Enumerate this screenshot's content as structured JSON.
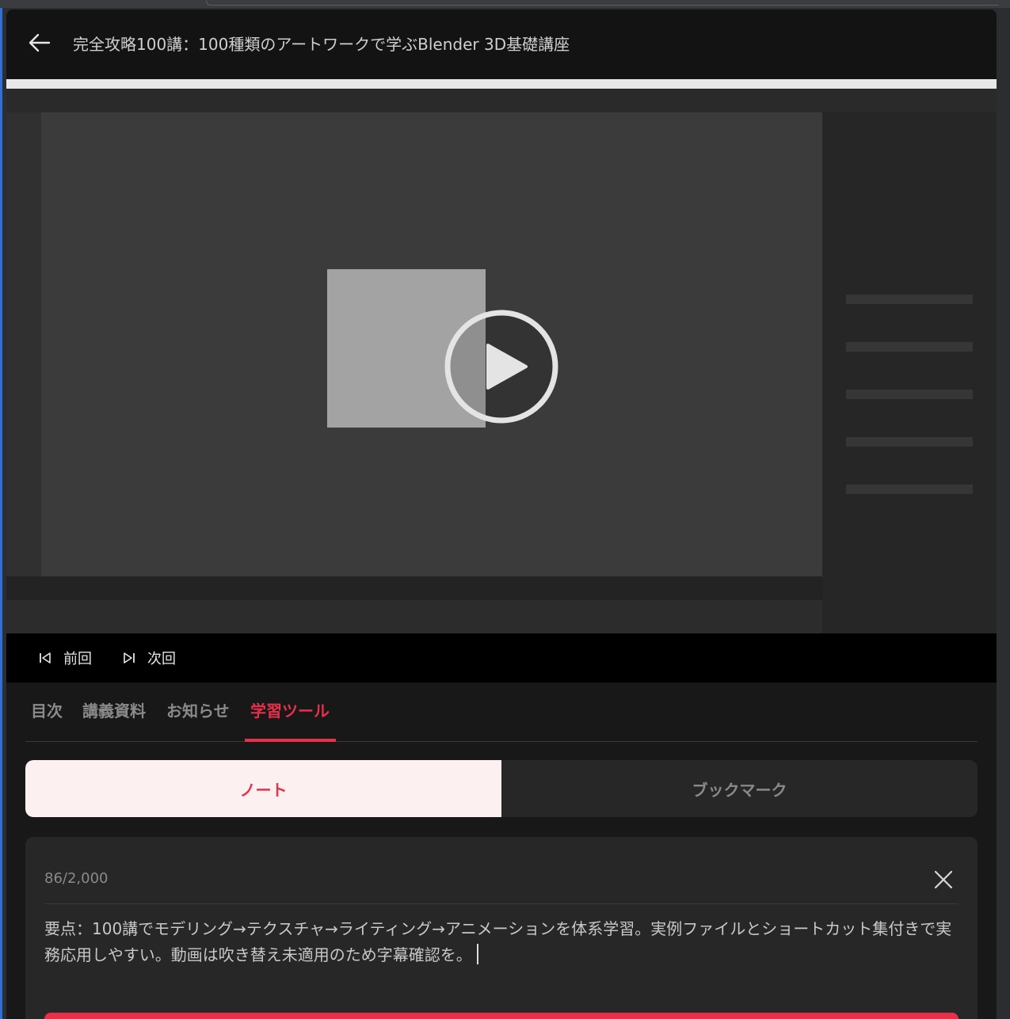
{
  "header": {
    "title": "完全攻略100講：100種類のアートワークで学ぶBlender 3D基礎講座",
    "back_icon": "arrow-left-icon"
  },
  "player": {
    "play_icon": "play-circle-icon",
    "prev_label": "前回",
    "next_label": "次回",
    "prev_icon": "skip-previous-icon",
    "next_icon": "skip-next-icon"
  },
  "tabs": [
    {
      "label": "目次",
      "active": false
    },
    {
      "label": "講義資料",
      "active": false
    },
    {
      "label": "お知らせ",
      "active": false
    },
    {
      "label": "学習ツール",
      "active": true
    }
  ],
  "segment": {
    "note_label": "ノート",
    "bookmark_label": "ブックマーク"
  },
  "note": {
    "counter": "86/2,000",
    "text": "要点：100講でモデリング→テクスチャ→ライティング→アニメーションを体系学習。実例ファイルとショートカット集付きで実務応用しやすい。動画は吹き替え未適用のため字幕確認を。",
    "close_icon": "close-icon"
  },
  "colors": {
    "accent": "#e8304a",
    "background": "#181818",
    "header": "#131313",
    "active_segment_bg": "#fdf0f0"
  }
}
